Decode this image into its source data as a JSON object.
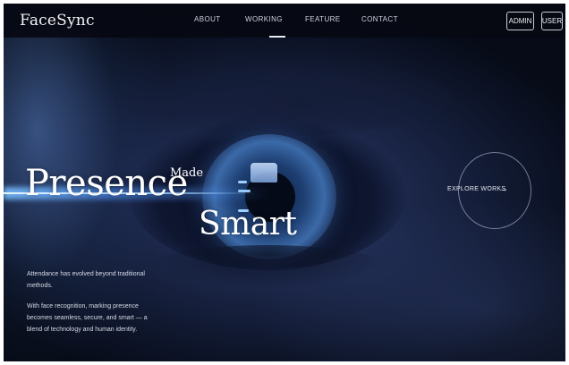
{
  "brand": {
    "logo_text": "FaceSync"
  },
  "nav": {
    "items": [
      {
        "label": "ABOUT"
      },
      {
        "label": "WORKING"
      },
      {
        "label": "FEATURE"
      },
      {
        "label": "CONTACT"
      }
    ],
    "active": "WORKING"
  },
  "actions": {
    "admin_label": "ADMIN",
    "user_label": "USER"
  },
  "hero": {
    "line1": "Presence",
    "connector": "Made",
    "line2": "Smart"
  },
  "description": {
    "paragraph1": "Attendance has evolved beyond traditional methods.",
    "paragraph2": "With face recognition, marking presence becomes seamless, secure, and smart — a blend of technology and human identity."
  },
  "cta": {
    "label": "EXPLORE WORKS",
    "arrow": "→"
  },
  "colors": {
    "nav_bg": "#06090f",
    "hero_bg": "#1a2546",
    "accent_glow": "#9fd0ff"
  },
  "icons": {
    "cta_icon": "arrow-right-icon"
  }
}
